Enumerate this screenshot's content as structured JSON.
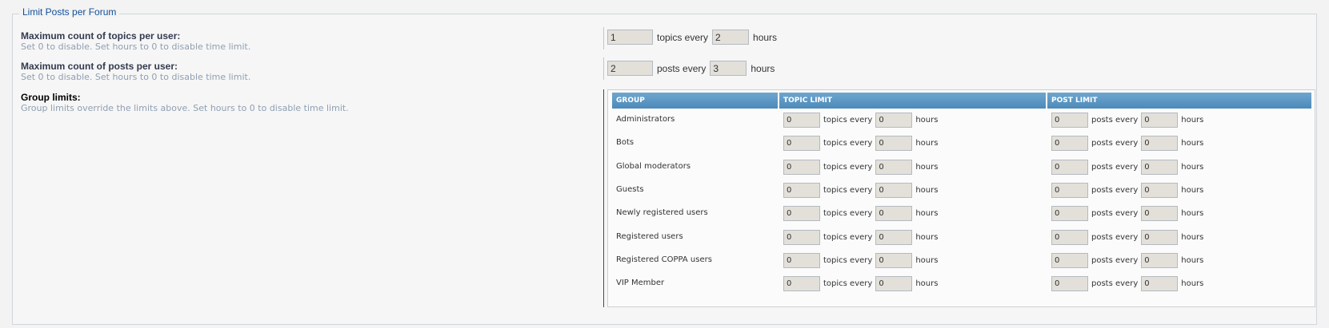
{
  "fieldset": {
    "legend": "Limit Posts per Forum"
  },
  "topics_row": {
    "title": "Maximum count of topics per user:",
    "desc": "Set 0 to disable. Set hours to 0 to disable time limit.",
    "count": "1",
    "mid_text": "topics every",
    "hours": "2",
    "hours_label": "hours"
  },
  "posts_row": {
    "title": "Maximum count of posts per user:",
    "desc": "Set 0 to disable. Set hours to 0 to disable time limit.",
    "count": "2",
    "mid_text": "posts every",
    "hours": "3",
    "hours_label": "hours"
  },
  "group_limits": {
    "title": "Group limits:",
    "desc": "Group limits override the limits above. Set hours to 0 to disable time limit.",
    "columns": [
      "Group",
      "Topic limit",
      "Post limit"
    ],
    "topic_text": "topics every",
    "post_text": "posts every",
    "hours_text": "hours",
    "groups": [
      {
        "name": "Administrators",
        "topic_count": "0",
        "topic_hours": "0",
        "post_count": "0",
        "post_hours": "0"
      },
      {
        "name": "Bots",
        "topic_count": "0",
        "topic_hours": "0",
        "post_count": "0",
        "post_hours": "0"
      },
      {
        "name": "Global moderators",
        "topic_count": "0",
        "topic_hours": "0",
        "post_count": "0",
        "post_hours": "0"
      },
      {
        "name": "Guests",
        "topic_count": "0",
        "topic_hours": "0",
        "post_count": "0",
        "post_hours": "0"
      },
      {
        "name": "Newly registered users",
        "topic_count": "0",
        "topic_hours": "0",
        "post_count": "0",
        "post_hours": "0"
      },
      {
        "name": "Registered users",
        "topic_count": "0",
        "topic_hours": "0",
        "post_count": "0",
        "post_hours": "0"
      },
      {
        "name": "Registered COPPA users",
        "topic_count": "0",
        "topic_hours": "0",
        "post_count": "0",
        "post_hours": "0"
      },
      {
        "name": "VIP Member",
        "topic_count": "0",
        "topic_hours": "0",
        "post_count": "0",
        "post_hours": "0"
      }
    ]
  }
}
